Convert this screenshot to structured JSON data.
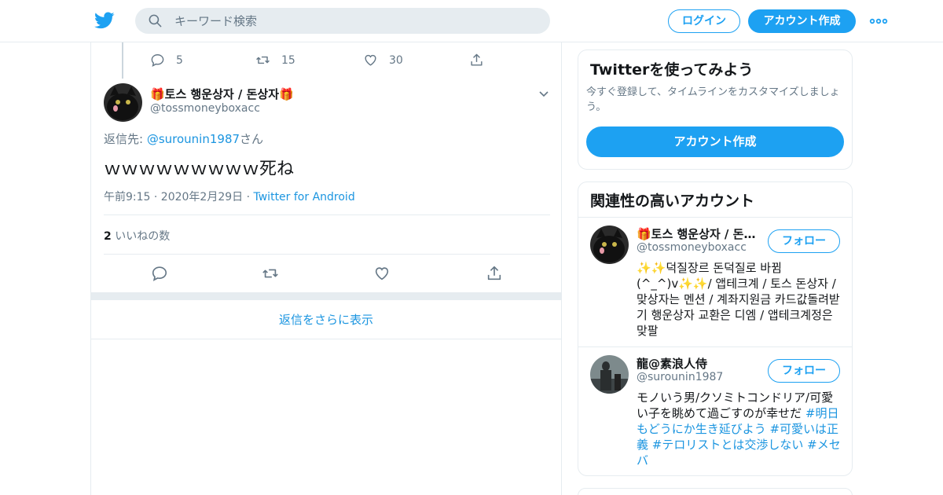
{
  "header": {
    "search_placeholder": "キーワード検索",
    "login_label": "ログイン",
    "signup_label": "アカウント作成",
    "brand_color": "#1da1f2"
  },
  "prev_tweet_actions": {
    "replies": "5",
    "retweets": "15",
    "likes": "30"
  },
  "tweet": {
    "name": "🎁토스 행운상자 / 돈상자🎁",
    "handle": "@tossmoneyboxacc",
    "reply_prefix": "返信先: ",
    "reply_to": "@surounin1987",
    "reply_suffix": "さん",
    "text": "ｗｗｗｗｗｗｗｗｗ死ね",
    "time": "午前9:15 · 2020年2月29日 · ",
    "source": "Twitter for Android",
    "like_count": "2",
    "like_label": " いいねの数"
  },
  "more_replies_label": "返信をさらに表示",
  "sidebar": {
    "signup_card": {
      "title": "Twitterを使ってみよう",
      "description": "今すぐ登録して、タイムラインをカスタマイズしましょう。",
      "button": "アカウント作成"
    },
    "related": {
      "title": "関連性の高いアカウント",
      "follow_label": "フォロー",
      "accounts": [
        {
          "name": "🎁토스 행운상자 / 돈상자🎁",
          "handle": "@tossmoneyboxacc",
          "bio": "✨✨덕질장르 돈덕질로 바뀜(^_^)v✨✨/ 앱테크계 / 토스 돈상자 / 맞상자는 멘션 / 계좌지원금 카드값돌려받기 행운상자 교환은 디엠 / 앱테크계정은 맞팔"
        },
        {
          "name": "龍@素浪人侍",
          "handle": "@surounin1987",
          "bio_text": "モノいう男/クソミトコンドリア/可愛い子を眺めて過ごすのが幸せだ ",
          "hashtags": [
            "#明日もどうにか生き延びよう",
            "#可愛いは正義",
            "#テロリストとは交渉しない",
            "#メセバ"
          ]
        }
      ]
    }
  }
}
